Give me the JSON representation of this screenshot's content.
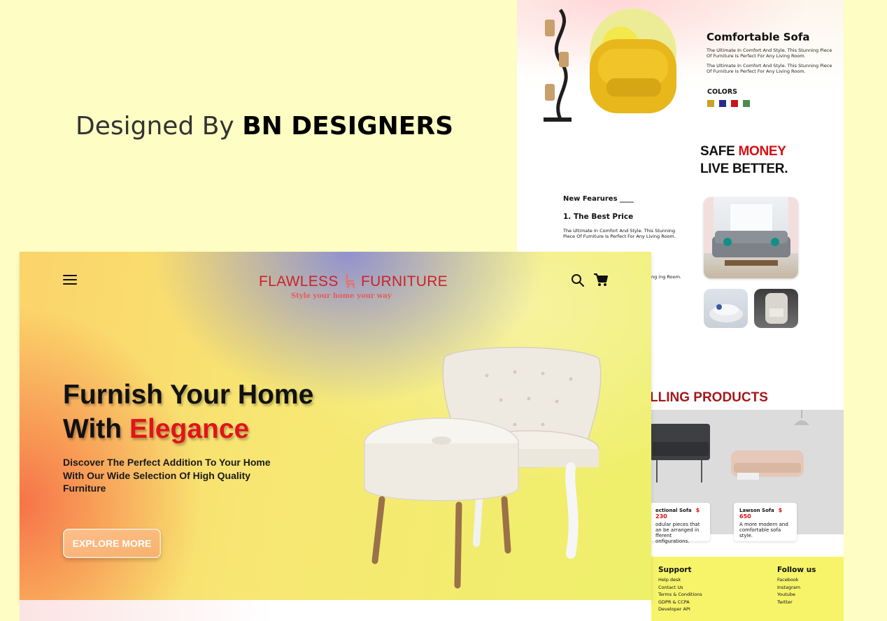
{
  "tagline": {
    "prefix": "Designed By ",
    "brand": "BN DESIGNERS"
  },
  "detail_page": {
    "product_title": "Comfortable Sofa",
    "product_desc_1": "The Ultimate In Comfort And Style. This Stunning Piece Of Furniture Is Perfect For Any Living Room.",
    "product_desc_2": "The Ultimate In Comfort And Style. This Stunning Piece Of Furniture Is Perfect For Any Living Room.",
    "colors_label": "COLORS",
    "swatches": [
      "#c9a227",
      "#2a2a8a",
      "#c8141c",
      "#4e8a4c"
    ],
    "promo_line1_a": "SAFE ",
    "promo_line1_b": "MONEY",
    "promo_line2": "LIVE BETTER.",
    "features_heading": "New Fearures ____",
    "feature_1_title": "1. The Best Price",
    "feature_1_desc": "The Ultimate In Comfort And Style. This Stunning Piece Of Furniture Is Perfect For Any Living Room.",
    "feature_2_desc": "Stunning ing Room.",
    "selling_heading": "LLING PRODUCTS",
    "products": [
      {
        "name": "ectional Sofa",
        "price": "$ 230",
        "desc": "odular pieces that an be arranged in fferent onfigurations."
      },
      {
        "name": "Lawson Sofa",
        "price": "$ 650",
        "desc": "A more modern and comfortable sofa style."
      }
    ],
    "footer": {
      "support_heading": "Support",
      "support_links": [
        "Help desk",
        "Contact Us",
        "Terms & Conditions",
        "GDPR & CCPA",
        "Developer API"
      ],
      "follow_heading": "Follow us",
      "follow_links": [
        "Facebook",
        "Instagram",
        "Youtube",
        "Twitter"
      ]
    }
  },
  "hero": {
    "logo_left": "FLAWLESS",
    "logo_right": "FURNITURE",
    "logo_tagline": "Style your home your way",
    "headline_line1": "Furnish Your Home",
    "headline_line2_a": "With ",
    "headline_line2_b": "Elegance",
    "subtext": "Discover The Perfect Addition To Your Home With Our Wide Selection Of High Quality Furniture",
    "cta_label": "EXPLORE MORE",
    "icons": {
      "menu": "hamburger-menu-icon",
      "search": "search-icon",
      "cart": "shopping-cart-icon"
    }
  }
}
